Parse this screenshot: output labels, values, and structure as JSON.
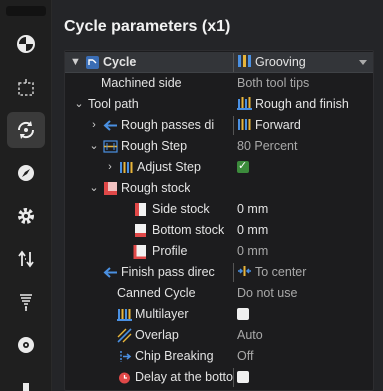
{
  "title": "Cycle parameters (x1)",
  "sidebar": {
    "items": [
      {
        "icon": "pie-chart-icon"
      },
      {
        "icon": "dashed-box-icon"
      },
      {
        "icon": "cycle-refresh-icon",
        "active": true
      },
      {
        "icon": "compass-icon"
      },
      {
        "icon": "gear-icon"
      },
      {
        "icon": "transfer-arrows-icon"
      },
      {
        "icon": "drill-tool-icon"
      },
      {
        "icon": "disc-icon"
      },
      {
        "icon": "square-icon"
      }
    ]
  },
  "rows": [
    {
      "name": "Cycle",
      "value": "Grooving"
    },
    {
      "name": "Machined side",
      "value": "Both tool tips"
    },
    {
      "name": "Tool path",
      "value": "Rough and finish"
    },
    {
      "name": "Rough passes di",
      "value": "Forward"
    },
    {
      "name": "Rough Step",
      "value": "80 Percent"
    },
    {
      "name": "Adjust Step",
      "checked": true
    },
    {
      "name": "Rough stock"
    },
    {
      "name": "Side stock",
      "value": "0 mm"
    },
    {
      "name": "Bottom stock",
      "value": "0 mm"
    },
    {
      "name": "Profile",
      "value": "0 mm"
    },
    {
      "name": "Finish pass direc",
      "value": "To center"
    },
    {
      "name": "Canned Cycle",
      "value": "Do not use"
    },
    {
      "name": "Multilayer",
      "checked": false
    },
    {
      "name": "Overlap",
      "value": "Auto"
    },
    {
      "name": "Chip Breaking",
      "value": "Off"
    },
    {
      "name": "Delay at the botto",
      "checked": false
    }
  ],
  "colors": {
    "accent_blue": "#4a90e2",
    "icon_yellow": "#e8b53a",
    "icon_red": "#e04848",
    "check_green": "#3c8b3c"
  }
}
